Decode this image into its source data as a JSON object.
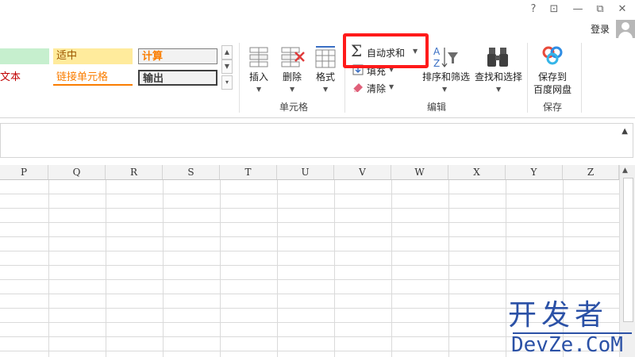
{
  "window": {
    "help_label": "?",
    "ribbon_display_label": "⊡",
    "minimize_label": "—",
    "restore_label": "⧉",
    "close_label": "✕",
    "login_label": "登录"
  },
  "ribbon": {
    "styles": {
      "row1": [
        {
          "label": "",
          "bg": "#c6efce"
        },
        {
          "label": "适中",
          "bg": "#ffeb9c",
          "color": "#9c5700"
        },
        {
          "label": "计算",
          "bg": "#f2f2f2",
          "color": "#fa7d00"
        }
      ],
      "row2": [
        {
          "label": "文本",
          "color": "#c00000"
        },
        {
          "label": "链接单元格",
          "color": "#fa7d00"
        },
        {
          "label": "输出",
          "bg": "#f2f2f2",
          "color": "#3f3f3f"
        }
      ]
    },
    "cells_group": {
      "label": "单元格",
      "insert_label": "插入",
      "delete_label": "删除",
      "format_label": "格式"
    },
    "edit_group": {
      "label": "编辑",
      "autosum_label": "自动求和",
      "fill_label": "填充",
      "clear_label": "清除",
      "sort_filter_label": "排序和筛选",
      "find_select_label": "查找和选择"
    },
    "save_group": {
      "label": "保存",
      "save_baidu_line1": "保存到",
      "save_baidu_line2": "百度网盘"
    },
    "colors": {
      "sigma": "#3a3a3a",
      "clear_icon": "#e0607a",
      "highlight": "#ff1a1a"
    }
  },
  "sheet": {
    "columns": [
      "P",
      "Q",
      "R",
      "S",
      "T",
      "U",
      "V",
      "W",
      "X",
      "Y",
      "Z"
    ]
  },
  "watermark": {
    "line1": "开发者",
    "line2": "DevZe.CoM"
  }
}
